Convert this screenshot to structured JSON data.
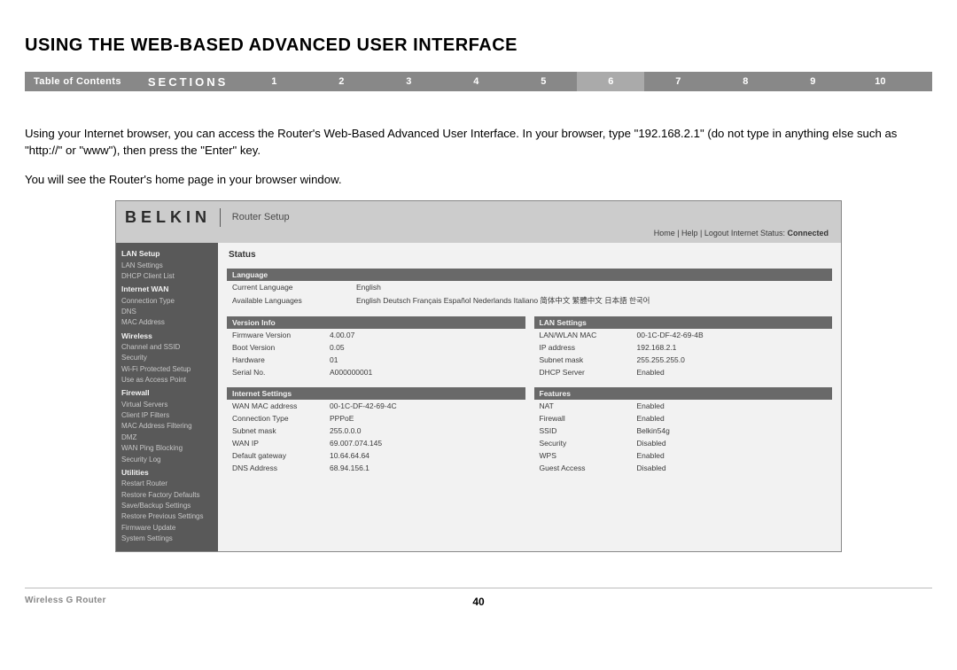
{
  "title": "USING THE WEB-BASED ADVANCED USER INTERFACE",
  "nav": {
    "toc": "Table of Contents",
    "sections_label": "SECTIONS",
    "items": [
      "1",
      "2",
      "3",
      "4",
      "5",
      "6",
      "7",
      "8",
      "9",
      "10"
    ],
    "active": "6"
  },
  "paragraphs": {
    "p1": "Using your Internet browser, you can access the Router's Web-Based Advanced User Interface. In your browser, type \"192.168.2.1\" (do not type in anything else such as \"http://\" or \"www\"), then press the \"Enter\" key.",
    "p2": "You will see the Router's home page in your browser window."
  },
  "screenshot": {
    "brand": "BELKIN",
    "subtitle": "Router Setup",
    "toplinks": "Home | Help | Logout   Internet Status:",
    "status_value": "Connected",
    "sidebar": [
      {
        "type": "cat",
        "label": "LAN Setup"
      },
      {
        "type": "item",
        "label": "LAN Settings"
      },
      {
        "type": "item",
        "label": "DHCP Client List"
      },
      {
        "type": "cat",
        "label": "Internet WAN"
      },
      {
        "type": "item",
        "label": "Connection Type"
      },
      {
        "type": "item",
        "label": "DNS"
      },
      {
        "type": "item",
        "label": "MAC Address"
      },
      {
        "type": "cat",
        "label": "Wireless"
      },
      {
        "type": "item",
        "label": "Channel and SSID"
      },
      {
        "type": "item",
        "label": "Security"
      },
      {
        "type": "item",
        "label": "Wi-Fi Protected Setup"
      },
      {
        "type": "item",
        "label": "Use as Access Point"
      },
      {
        "type": "cat",
        "label": "Firewall"
      },
      {
        "type": "item",
        "label": "Virtual Servers"
      },
      {
        "type": "item",
        "label": "Client IP Filters"
      },
      {
        "type": "item",
        "label": "MAC Address Filtering"
      },
      {
        "type": "item",
        "label": "DMZ"
      },
      {
        "type": "item",
        "label": "WAN Ping Blocking"
      },
      {
        "type": "item",
        "label": "Security Log"
      },
      {
        "type": "cat",
        "label": "Utilities"
      },
      {
        "type": "item",
        "label": "Restart Router"
      },
      {
        "type": "item",
        "label": "Restore Factory Defaults"
      },
      {
        "type": "item",
        "label": "Save/Backup Settings"
      },
      {
        "type": "item",
        "label": "Restore Previous Settings"
      },
      {
        "type": "item",
        "label": "Firmware Update"
      },
      {
        "type": "item",
        "label": "System Settings"
      }
    ],
    "status_heading": "Status",
    "language": {
      "header": "Language",
      "rows": [
        {
          "k": "Current Language",
          "v": "English"
        },
        {
          "k": "Available Languages",
          "v": "English  Deutsch  Français  Español  Nederlands  Italiano  简体中文  繁體中文  日本語  한국어"
        }
      ]
    },
    "version": {
      "header": "Version Info",
      "rows": [
        {
          "k": "Firmware Version",
          "v": "4.00.07"
        },
        {
          "k": "Boot Version",
          "v": "0.05"
        },
        {
          "k": "Hardware",
          "v": "01"
        },
        {
          "k": "Serial No.",
          "v": "A000000001"
        }
      ]
    },
    "lan": {
      "header": "LAN Settings",
      "rows": [
        {
          "k": "LAN/WLAN MAC",
          "v": "00-1C-DF-42-69-4B"
        },
        {
          "k": "IP address",
          "v": "192.168.2.1"
        },
        {
          "k": "Subnet mask",
          "v": "255.255.255.0"
        },
        {
          "k": "DHCP Server",
          "v": "Enabled"
        }
      ]
    },
    "internet": {
      "header": "Internet Settings",
      "rows": [
        {
          "k": "WAN MAC address",
          "v": "00-1C-DF-42-69-4C"
        },
        {
          "k": "Connection Type",
          "v": "PPPoE"
        },
        {
          "k": "Subnet mask",
          "v": "255.0.0.0"
        },
        {
          "k": "WAN IP",
          "v": "69.007.074.145"
        },
        {
          "k": "Default gateway",
          "v": "10.64.64.64"
        },
        {
          "k": "DNS Address",
          "v": "68.94.156.1"
        }
      ]
    },
    "features": {
      "header": "Features",
      "rows": [
        {
          "k": "NAT",
          "v": "Enabled"
        },
        {
          "k": "Firewall",
          "v": "Enabled"
        },
        {
          "k": "SSID",
          "v": "Belkin54g"
        },
        {
          "k": "Security",
          "v": "Disabled"
        },
        {
          "k": "WPS",
          "v": "Enabled"
        },
        {
          "k": "Guest Access",
          "v": "Disabled"
        }
      ]
    }
  },
  "footer": {
    "left": "Wireless G Router",
    "page": "40"
  }
}
